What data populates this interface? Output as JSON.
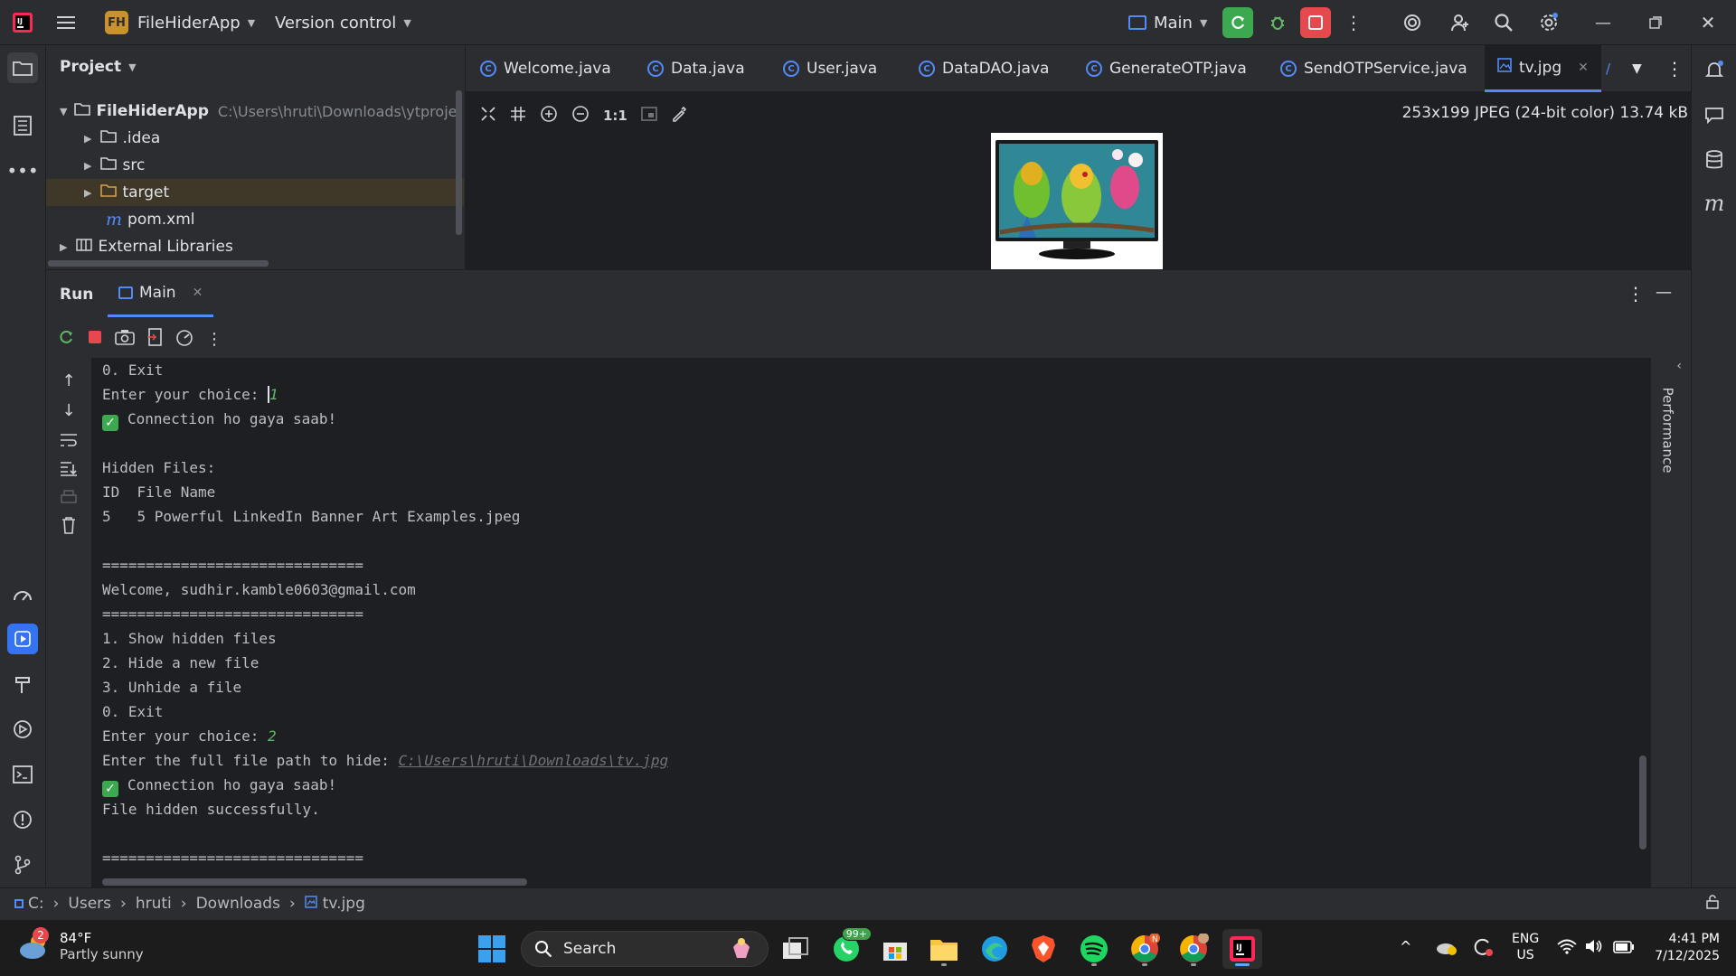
{
  "titlebar": {
    "app_icon": "intellij-logo",
    "project_badge": "FH",
    "project_name": "FileHiderApp",
    "vcs_label": "Version control",
    "run_config": "Main"
  },
  "project_panel": {
    "title": "Project",
    "tree": [
      {
        "label": "FileHiderApp",
        "path": "C:\\Users\\hruti\\Downloads\\ytproject-",
        "icon": "folder-icon"
      },
      {
        "label": ".idea",
        "icon": "folder-icon"
      },
      {
        "label": "src",
        "icon": "folder-icon"
      },
      {
        "label": "target",
        "icon": "folder-icon"
      },
      {
        "label": "pom.xml",
        "icon": "maven-icon"
      },
      {
        "label": "External Libraries",
        "icon": "library-icon"
      }
    ]
  },
  "tabs": [
    {
      "label": "Welcome.java"
    },
    {
      "label": "Data.java"
    },
    {
      "label": "User.java"
    },
    {
      "label": "DataDAO.java"
    },
    {
      "label": "GenerateOTP.java"
    },
    {
      "label": "SendOTPService.java"
    },
    {
      "label": "tv.jpg",
      "active": true
    }
  ],
  "image_viewer": {
    "zoom_label": "1:1",
    "info": "253x199 JPEG (24-bit color) 13.74 kB"
  },
  "run_panel": {
    "title": "Run",
    "tab_label": "Main",
    "side_label": "Performance"
  },
  "console": {
    "l1": "0. Exit",
    "l2_prefix": "Enter your choice: ",
    "l2_value": "1",
    "l3": "Connection ho gaya saab!",
    "l5": "Hidden Files:",
    "l6": "ID  File Name",
    "l7": "5   5 Powerful LinkedIn Banner Art Examples.jpeg",
    "l9": "==============================",
    "l10": "Welcome, sudhir.kamble0603@gmail.com",
    "l11": "==============================",
    "l12": "1. Show hidden files",
    "l13": "2. Hide a new file",
    "l14": "3. Unhide a file",
    "l15": "0. Exit",
    "l16_prefix": "Enter your choice: ",
    "l16_value": "2",
    "l17_prefix": "Enter the full file path to hide: ",
    "l17_path": "C:\\Users\\hruti\\Downloads\\tv.jpg",
    "l18": "Connection ho gaya saab!",
    "l19": "File hidden successfully.",
    "l21": "=============================="
  },
  "breadcrumb": [
    "C:",
    "Users",
    "hruti",
    "Downloads",
    "tv.jpg"
  ],
  "taskbar": {
    "weather_temp": "84°F",
    "weather_desc": "Partly sunny",
    "weather_badge": "2",
    "search_label": "Search",
    "whatsapp_badge": "99+",
    "lang_top": "ENG",
    "lang_bottom": "US",
    "time": "4:41 PM",
    "date": "7/12/2025"
  },
  "colors": {
    "accent": "#548af7",
    "run_green": "#3ca84f",
    "stop_red": "#e5484d",
    "project_badge": "#c9922f"
  }
}
